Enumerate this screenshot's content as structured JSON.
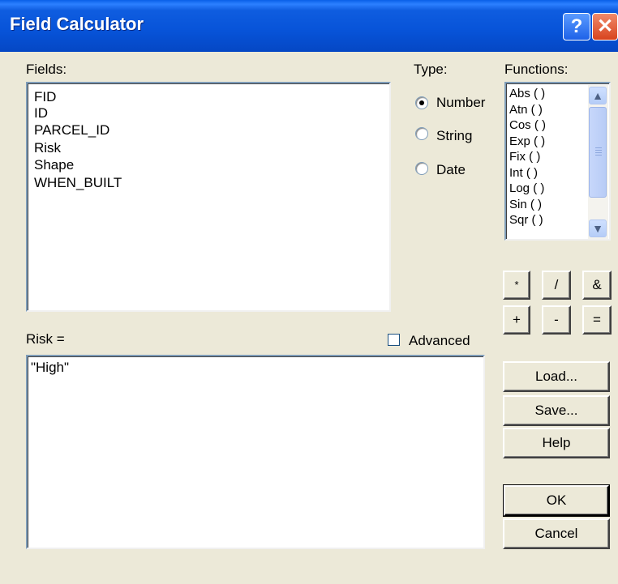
{
  "window": {
    "title": "Field Calculator"
  },
  "titlebar": {
    "help_glyph": "?",
    "close_glyph": "✕"
  },
  "fields": {
    "label": "Fields:",
    "items": [
      "FID",
      "ID",
      "PARCEL_ID",
      "Risk",
      "Shape",
      "WHEN_BUILT"
    ]
  },
  "type": {
    "label": "Type:",
    "options": [
      {
        "label": "Number",
        "selected": true
      },
      {
        "label": "String",
        "selected": false
      },
      {
        "label": "Date",
        "selected": false
      }
    ]
  },
  "functions": {
    "label": "Functions:",
    "items": [
      "Abs ( )",
      "Atn ( )",
      "Cos ( )",
      "Exp ( )",
      "Fix ( )",
      "Int ( )",
      "Log ( )",
      "Sin ( )",
      "Sqr ( )"
    ]
  },
  "operators": [
    "*",
    "/",
    "&",
    "+",
    "-",
    "="
  ],
  "expression": {
    "label": "Risk =",
    "value": "\"High\""
  },
  "advanced": {
    "label": "Advanced",
    "checked": false
  },
  "buttons": {
    "load": "Load...",
    "save": "Save...",
    "help": "Help",
    "ok": "OK",
    "cancel": "Cancel"
  },
  "icons": {
    "scroll_up": "▲",
    "scroll_down": "▼"
  }
}
